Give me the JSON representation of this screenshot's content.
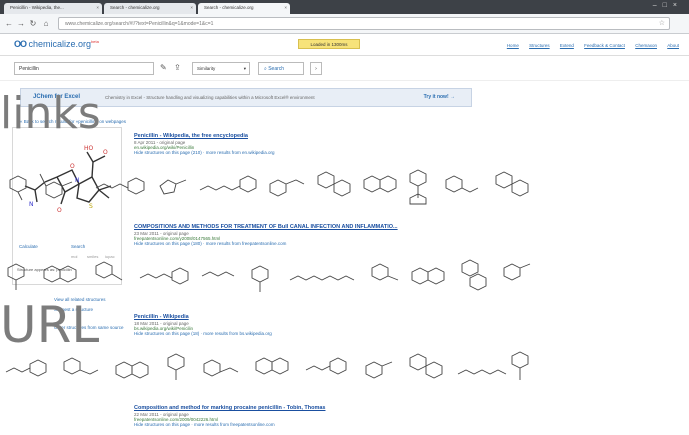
{
  "browser": {
    "tabs": [
      {
        "label": "Penicillin - Wikipedia, the..."
      },
      {
        "label": "Search - chemicalize.org"
      },
      {
        "label": "Search - chemicalize.org"
      }
    ],
    "url": "www.chemicalize.org/search/#!/?text=Penicillin&q=1&mode=1&c=1"
  },
  "header": {
    "logo": "chemicalize.org",
    "logo_badge": "beta",
    "loaded_badge": "Loaded in 1300ms",
    "nav": [
      "Home",
      "Structures",
      "Extend",
      "Feedback & Contact",
      "Chemaxon",
      "About"
    ]
  },
  "search": {
    "query": "Penicillin",
    "mode": "Similarity",
    "button": "Search"
  },
  "banner": {
    "title": "JChem for Excel",
    "description": "Chemistry in Excel - Structure handling and visualizing capabilities within a Microsoft Excel® environment",
    "cta": "Try it now! →"
  },
  "breadcrumb": "« Back to search results for «penicillin» on webpages",
  "left_panel": {
    "link_a": "Calculate",
    "link_b": "Search",
    "small_a": "mol",
    "small_b": "smiles",
    "small_c": "iupac",
    "note": "Structure appears as: penicillin",
    "side_links": [
      "View all related structures",
      "Suggest a structure",
      "Other structures from same source"
    ]
  },
  "results": [
    {
      "title": "Penicillin - Wikipedia, the free encyclopedia",
      "meta": "8 Apr 2011 - original page",
      "url": "en.wikipedia.org/wiki/Penicillin",
      "links": "Hide structures on this page (210)  ·  more results from en.wikipedia.org"
    },
    {
      "title": "COMPOSITIONS AND METHODS FOR TREATMENT OF Bull CANAL INFECTION AND INFLAMMATIO...",
      "meta": "23 Mar 2011 - original page",
      "url": "freepatentsonline.com/y2008/0147565.html",
      "links": "Hide structures on this page (180)  ·  more results from freepatentsonline.com"
    },
    {
      "title": "Penicillin - Wikipedia",
      "meta": "18 Mar 2011 - original page",
      "url": "bs.wikipedia.org/wiki/Penicilin",
      "links": "Hide structures on this page (18)  ·  more results from bs.wikipedia.org"
    },
    {
      "title": "Composition and method for marking procaine penicillin - Tobin, Thomas",
      "meta": "22 Mar 2011 - original page",
      "url": "freepatentsonline.com/2009/0042226.html",
      "links": "Hide structures on this page  ·  more results from freepatentsonline.com"
    }
  ],
  "overlay": {
    "word1": "links",
    "word2": "URL"
  }
}
